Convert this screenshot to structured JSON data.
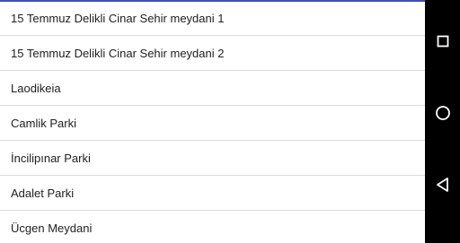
{
  "list": {
    "items": [
      {
        "label": "15 Temmuz Delikli Cinar Sehir meydani 1"
      },
      {
        "label": "15 Temmuz Delikli Cinar Sehir meydani 2"
      },
      {
        "label": "Laodikeia"
      },
      {
        "label": "Camlik Parki"
      },
      {
        "label": "İncilipınar Parki"
      },
      {
        "label": "Adalet Parki"
      },
      {
        "label": "Ücgen Meydani"
      }
    ]
  },
  "navbar": {
    "buttons": [
      {
        "icon": "square-recents-icon"
      },
      {
        "icon": "circle-home-icon"
      },
      {
        "icon": "triangle-back-icon"
      }
    ]
  },
  "colors": {
    "accent": "#3f51b5",
    "navbar": "#000000",
    "divider": "#dcdcdc",
    "text": "#212121"
  }
}
